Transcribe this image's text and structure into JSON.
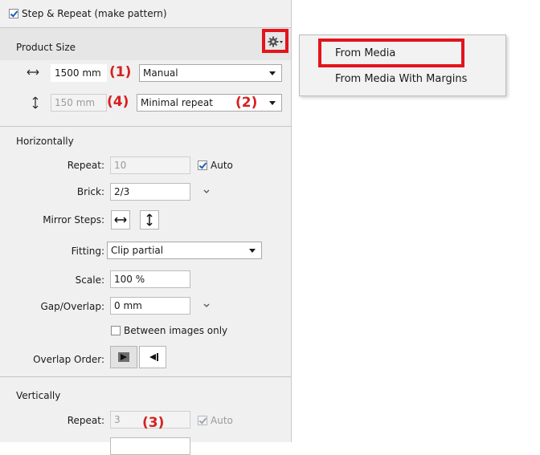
{
  "step_repeat": {
    "checked": true,
    "label": "Step & Repeat (make pattern)"
  },
  "product_size": {
    "title": "Product Size",
    "gear_icon": "gear-icon",
    "width": {
      "icon": "horizontal-arrow-icon",
      "value": "1500 mm",
      "mode": "Manual"
    },
    "height": {
      "icon": "vertical-arrow-icon",
      "value": "150 mm",
      "mode": "Minimal repeat"
    }
  },
  "gear_menu": {
    "items": [
      {
        "label": "From Media"
      },
      {
        "label": "From Media With Margins"
      }
    ]
  },
  "annotations": [
    "(1)",
    "(4)",
    "(2)",
    "(3)"
  ],
  "horizontally": {
    "title": "Horizontally",
    "repeat": {
      "label": "Repeat:",
      "value": "10",
      "auto_label": "Auto",
      "auto_checked": true
    },
    "brick": {
      "label": "Brick:",
      "value": "2/3"
    },
    "mirror_steps": {
      "label": "Mirror Steps:"
    },
    "fitting": {
      "label": "Fitting:",
      "value": "Clip partial"
    },
    "scale": {
      "label": "Scale:",
      "value": "100 %"
    },
    "gap_overlap": {
      "label": "Gap/Overlap:",
      "value": "0 mm"
    },
    "between_images": {
      "label": "Between images only",
      "checked": false
    },
    "overlap_order": {
      "label": "Overlap Order:"
    }
  },
  "vertically": {
    "title": "Vertically",
    "repeat": {
      "label": "Repeat:",
      "value": "3",
      "auto_label": "Auto",
      "auto_checked": true
    }
  },
  "colors": {
    "annotation": "#e3141c",
    "check": "#1d5fb8"
  }
}
